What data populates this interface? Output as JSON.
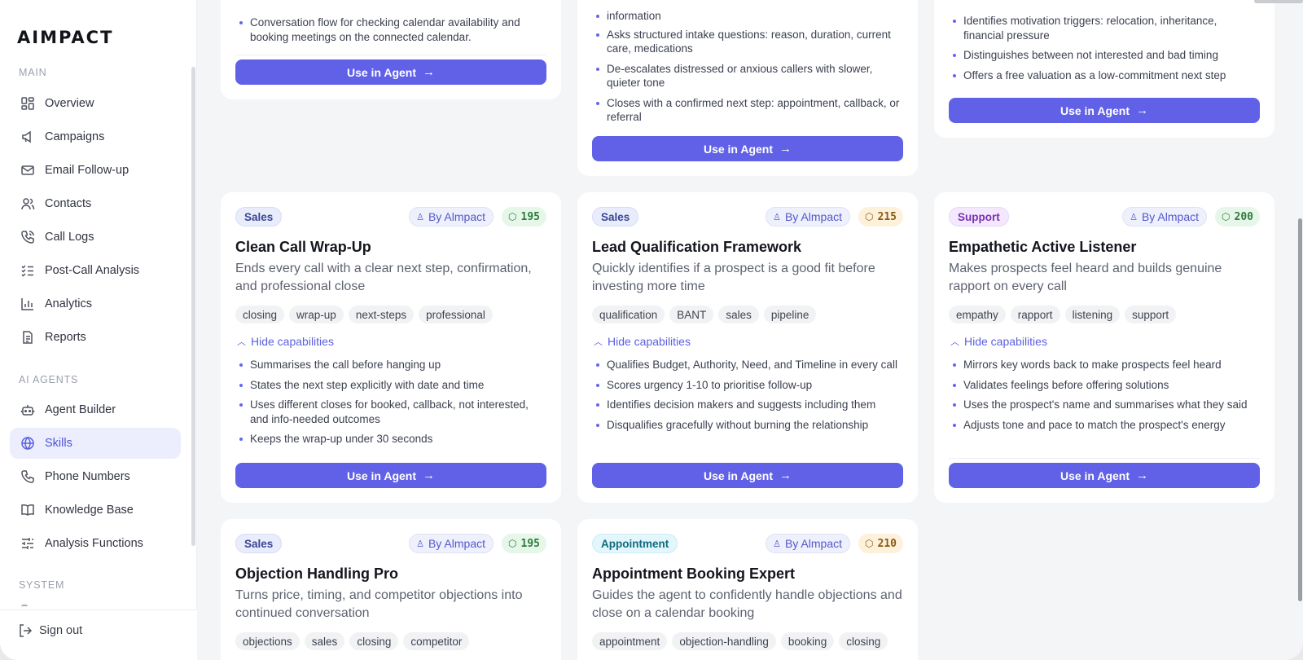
{
  "app": {
    "logo": "AIMPACT"
  },
  "sidebar": {
    "sections": {
      "main": "MAIN",
      "ai_agents": "AI AGENTS",
      "system": "SYSTEM"
    },
    "items": [
      {
        "label": "Overview",
        "icon": "grid-icon"
      },
      {
        "label": "Campaigns",
        "icon": "megaphone-icon"
      },
      {
        "label": "Email Follow-up",
        "icon": "mail-icon"
      },
      {
        "label": "Contacts",
        "icon": "users-icon"
      },
      {
        "label": "Call Logs",
        "icon": "phone-call-icon"
      },
      {
        "label": "Post-Call Analysis",
        "icon": "checklist-icon"
      },
      {
        "label": "Analytics",
        "icon": "bar-chart-icon"
      },
      {
        "label": "Reports",
        "icon": "document-icon"
      },
      {
        "label": "Agent Builder",
        "icon": "robot-icon"
      },
      {
        "label": "Skills",
        "icon": "globe-icon",
        "active": true
      },
      {
        "label": "Phone Numbers",
        "icon": "phone-icon"
      },
      {
        "label": "Knowledge Base",
        "icon": "book-icon"
      },
      {
        "label": "Analysis Functions",
        "icon": "sliders-icon"
      }
    ],
    "sign_out": "Sign out"
  },
  "common": {
    "use_in_agent": "Use in Agent",
    "hide_capabilities": "Hide capabilities",
    "by_label": "By Almpact"
  },
  "top_cards": [
    {
      "capabilities": [
        "Conversation flow for checking calendar availability and booking meetings on the connected calendar."
      ]
    },
    {
      "capabilities": [
        "information",
        "Asks structured intake questions: reason, duration, current care, medications",
        "De-escalates distressed or anxious callers with slower, quieter tone",
        "Closes with a confirmed next step: appointment, callback, or referral"
      ]
    },
    {
      "capabilities": [
        "Identifies motivation triggers: relocation, inheritance, financial pressure",
        "Distinguishes between not interested and bad timing",
        "Offers a free valuation as a low-commitment next step"
      ]
    }
  ],
  "cards": [
    {
      "category": "Sales",
      "score": "195",
      "score_color": "#2f7a3d",
      "title": "Clean Call Wrap-Up",
      "description": "Ends every call with a clear next step, confirmation, and professional close",
      "tags": [
        "closing",
        "wrap-up",
        "next-steps",
        "professional"
      ],
      "capabilities": [
        "Summarises the call before hanging up",
        "States the next step explicitly with date and time",
        "Uses different closes for booked, callback, not interested, and info-needed outcomes",
        "Keeps the wrap-up under 30 seconds"
      ]
    },
    {
      "category": "Sales",
      "score": "215",
      "score_color": "#8b5a12",
      "title": "Lead Qualification Framework",
      "description": "Quickly identifies if a prospect is a good fit before investing more time",
      "tags": [
        "qualification",
        "BANT",
        "sales",
        "pipeline"
      ],
      "capabilities": [
        "Qualifies Budget, Authority, Need, and Timeline in every call",
        "Scores urgency 1-10 to prioritise follow-up",
        "Identifies decision makers and suggests including them",
        "Disqualifies gracefully without burning the relationship"
      ]
    },
    {
      "category": "Support",
      "score": "200",
      "score_color": "#2f7a3d",
      "title": "Empathetic Active Listener",
      "description": "Makes prospects feel heard and builds genuine rapport on every call",
      "tags": [
        "empathy",
        "rapport",
        "listening",
        "support"
      ],
      "capabilities": [
        "Mirrors key words back to make prospects feel heard",
        "Validates feelings before offering solutions",
        "Uses the prospect's name and summarises what they said",
        "Adjusts tone and pace to match the prospect's energy"
      ]
    },
    {
      "category": "Sales",
      "score": "195",
      "score_color": "#2f7a3d",
      "title": "Objection Handling Pro",
      "description": "Turns price, timing, and competitor objections into continued conversation",
      "tags": [
        "objections",
        "sales",
        "closing",
        "competitor"
      ]
    },
    {
      "category": "Appointment",
      "score": "210",
      "score_color": "#8b5a12",
      "title": "Appointment Booking Expert",
      "description": "Guides the agent to confidently handle objections and close on a calendar booking",
      "tags": [
        "appointment",
        "objection-handling",
        "booking",
        "closing"
      ]
    }
  ],
  "colors": {
    "accent": "#6061e6",
    "active_nav_bg": "#eceefd"
  }
}
